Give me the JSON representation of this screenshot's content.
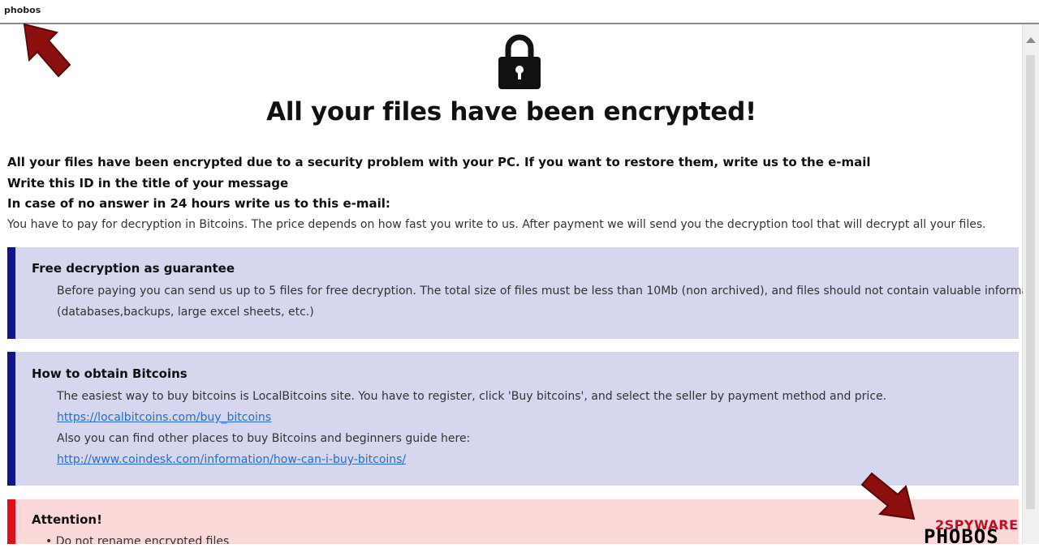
{
  "window": {
    "title": "phobos"
  },
  "headline": "All your files have been encrypted!",
  "intro": {
    "line1": "All your files have been encrypted due to a security problem with your PC. If you want to restore them, write us to the e-mail",
    "line2": "Write this ID in the title of your message",
    "line3": "In case of no answer in 24 hours write us to this e-mail:",
    "line4": "You have to pay for decryption in Bitcoins. The price depends on how fast you write to us. After payment we will send you the decryption tool that will decrypt all your files."
  },
  "guarantee": {
    "title": "Free decryption as guarantee",
    "text1": "Before paying you can send us up to 5 files for free decryption. The total size of files must be less than 10Mb (non archived), and files should not contain valuable information.",
    "text2": "(databases,backups, large excel sheets, etc.)"
  },
  "bitcoins": {
    "title": "How to obtain Bitcoins",
    "text1": "The easiest way to buy bitcoins is LocalBitcoins site. You have to register, click 'Buy bitcoins', and select the seller by payment method and price.",
    "link1": "https://localbitcoins.com/buy_bitcoins",
    "text2": "Also you can find other places to buy Bitcoins and beginners guide here:",
    "link2": "http://www.coindesk.com/information/how-can-i-buy-bitcoins/"
  },
  "attention": {
    "title": "Attention!",
    "item1": "Do not rename encrypted files"
  },
  "watermark": {
    "top": "2SPYWARE",
    "brand": "PHOBOS"
  },
  "colors": {
    "info_box_bg": "#d6d6ee",
    "info_box_accent": "#12128a",
    "attention_bg": "#fbd8d8",
    "attention_accent": "#e0101a",
    "link": "#2a6cc8",
    "arrow": "#8b0f0f"
  },
  "icons": {
    "lock": "padlock-icon",
    "arrow": "pointer-arrow-icon",
    "scroll_up": "scroll-up-arrow-icon"
  }
}
